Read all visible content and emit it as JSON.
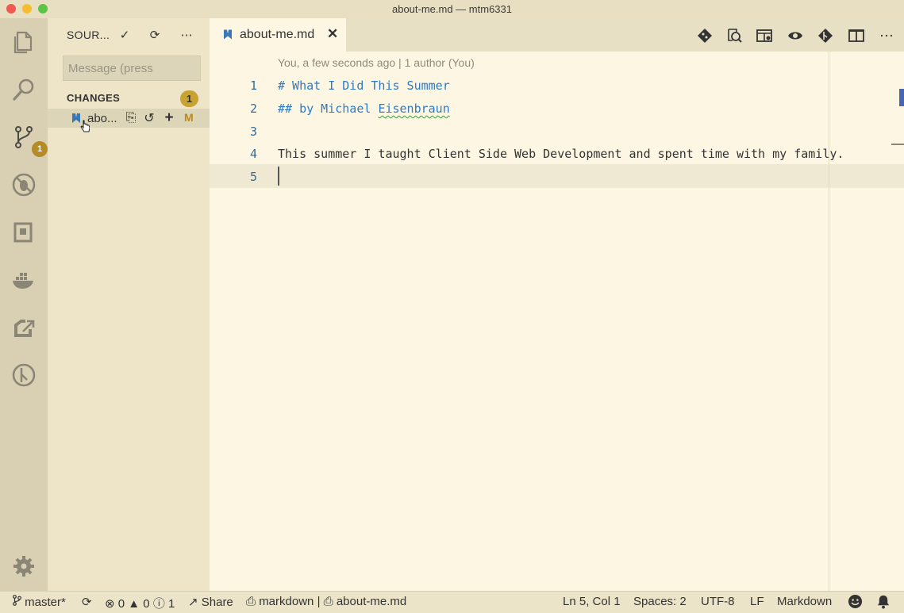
{
  "window": {
    "title": "about-me.md — mtm6331"
  },
  "activity_bar": {
    "items": [
      "explorer-icon",
      "search-icon",
      "source-control-icon",
      "debug-icon",
      "extensions-icon",
      "docker-icon",
      "live-share-icon",
      "gitlens-icon"
    ],
    "scm_badge": "1",
    "settings": "gear-icon"
  },
  "sidebar": {
    "title": "SOUR...",
    "commit_placeholder": "Message (press",
    "changes_label": "CHANGES",
    "changes_count": "1",
    "file": {
      "name": "abo...",
      "status": "M"
    }
  },
  "editor": {
    "tab_label": "about-me.md",
    "blame": "You, a few seconds ago | 1 author (You)",
    "lines": [
      {
        "num": "1",
        "text": "# What I Did This Summer"
      },
      {
        "num": "2",
        "prefix": "## by Michael ",
        "flagged": "Eisenbraun"
      },
      {
        "num": "3",
        "text": ""
      },
      {
        "num": "4",
        "text": "This summer I taught Client Side Web Development and spent time with my family."
      },
      {
        "num": "5",
        "text": ""
      }
    ]
  },
  "status_bar": {
    "branch": "master*",
    "errors": "0",
    "warnings": "0",
    "info": "1",
    "share": "Share",
    "breadcrumb_folder": "markdown",
    "breadcrumb_sep": "|",
    "breadcrumb_file": "about-me.md",
    "position": "Ln 5, Col 1",
    "spaces": "Spaces: 2",
    "encoding": "UTF-8",
    "eol": "LF",
    "language": "Markdown"
  },
  "colors": {
    "accent": "#2d7bc4",
    "badge": "#b48b24",
    "modified": "#b98a1c"
  }
}
